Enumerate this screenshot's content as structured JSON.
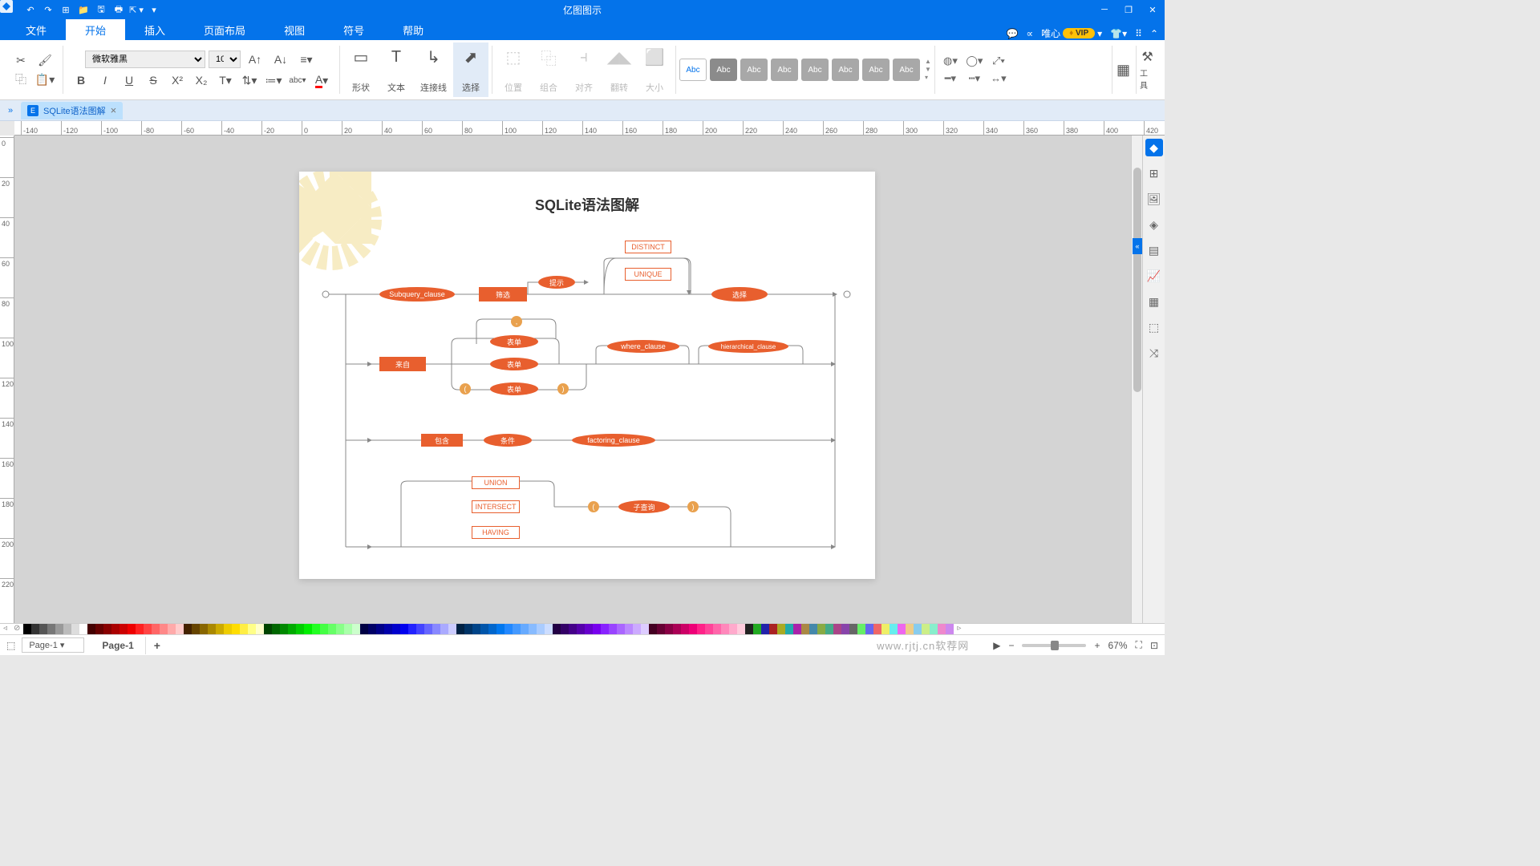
{
  "app": {
    "title": "亿图图示"
  },
  "menu": {
    "tabs": [
      "文件",
      "开始",
      "插入",
      "页面布局",
      "视图",
      "符号",
      "帮助"
    ],
    "active": 1,
    "right": {
      "user": "唯心",
      "vip": "VIP"
    }
  },
  "ribbon": {
    "font": {
      "name": "微软雅黑",
      "size": "10"
    },
    "bigtools": {
      "shape": "形状",
      "text": "文本",
      "connector": "连接线",
      "select": "选择"
    },
    "arrange": {
      "position": "位置",
      "group": "组合",
      "align": "对齐",
      "flip": "翻转",
      "size": "大小"
    },
    "styles": [
      "Abc",
      "Abc",
      "Abc",
      "Abc",
      "Abc",
      "Abc",
      "Abc",
      "Abc"
    ],
    "tools_label": "工具"
  },
  "doctab": {
    "name": "SQLite语法图解"
  },
  "ruler_h": [
    -140,
    -120,
    -100,
    -80,
    -60,
    -40,
    -20,
    0,
    20,
    40,
    60,
    80,
    100,
    120,
    140,
    160,
    180,
    200,
    220,
    240,
    260,
    280,
    300,
    320,
    340,
    360,
    380,
    400,
    420
  ],
  "ruler_v": [
    0,
    20,
    40,
    60,
    80,
    100,
    120,
    140,
    160,
    180,
    200,
    220
  ],
  "diagram": {
    "title": "SQLite语法图解",
    "nodes": {
      "subquery": "Subquery_clause",
      "filter": "筛选",
      "hint": "提示",
      "distinct": "DISTINCT",
      "unique": "UNIQUE",
      "select": "选择",
      "from": "来自",
      "table1": "表单",
      "table2": "表单",
      "table3": "表单",
      "comma": ",",
      "lparen": "(",
      "rparen": ")",
      "where": "where_clause",
      "hier": "hierarchical_clause",
      "contain": "包含",
      "cond": "条件",
      "factoring": "factoring_clause",
      "union": "UNION",
      "intersect": "INTERSECT",
      "having": "HAVING",
      "subq2": "子查询",
      "lparen2": "(",
      "rparen2": ")"
    }
  },
  "status": {
    "page_sel": "Page-1",
    "page_tab": "Page-1",
    "zoom": "67%",
    "watermark": "www.rjtj.cn软荐网"
  },
  "colors": [
    "#000",
    "#333",
    "#555",
    "#777",
    "#999",
    "#bbb",
    "#ddd",
    "#fff",
    "#400",
    "#600",
    "#800",
    "#a00",
    "#c00",
    "#e00",
    "#f22",
    "#f44",
    "#f66",
    "#f88",
    "#faa",
    "#fcc",
    "#420",
    "#640",
    "#860",
    "#a80",
    "#ca0",
    "#ec0",
    "#fd0",
    "#fe4",
    "#ff8",
    "#ffc",
    "#040",
    "#060",
    "#080",
    "#0a0",
    "#0c0",
    "#0e0",
    "#2f2",
    "#4f4",
    "#6f6",
    "#8f8",
    "#afa",
    "#cfc",
    "#004",
    "#006",
    "#008",
    "#00a",
    "#00c",
    "#00e",
    "#22f",
    "#44f",
    "#66f",
    "#88f",
    "#aaf",
    "#ccf",
    "#024",
    "#036",
    "#048",
    "#05a",
    "#06c",
    "#07e",
    "#28f",
    "#49f",
    "#6af",
    "#8bf",
    "#acf",
    "#cdf",
    "#204",
    "#306",
    "#408",
    "#50a",
    "#60c",
    "#70e",
    "#82f",
    "#94f",
    "#a6f",
    "#b8f",
    "#caf",
    "#dcf",
    "#402",
    "#603",
    "#804",
    "#a05",
    "#c06",
    "#e07",
    "#f28",
    "#f49",
    "#f6a",
    "#f8b",
    "#fac",
    "#fcd",
    "#222",
    "#2a2",
    "#22a",
    "#a22",
    "#aa2",
    "#2aa",
    "#a2a",
    "#a84",
    "#48a",
    "#8a4",
    "#4a8",
    "#a48",
    "#84a",
    "#666",
    "#6e6",
    "#66e",
    "#e66",
    "#ee6",
    "#6ee",
    "#e6e",
    "#ec8",
    "#8ce",
    "#ce8",
    "#8ec",
    "#e8c",
    "#c8e"
  ]
}
